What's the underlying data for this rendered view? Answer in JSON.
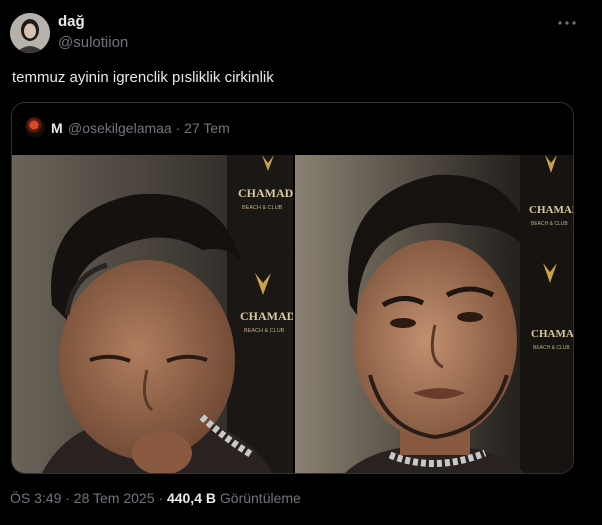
{
  "author": {
    "name": "dağ",
    "handle": "@sulotiion"
  },
  "menu_icon": "more-horizontal-icon",
  "tweet_text": "temmuz ayinin igrenclik pısliklik cirkinlik",
  "quoted": {
    "name": "M",
    "handle": "@osekilgelamaa",
    "separator": "·",
    "date": "27 Tem",
    "images": [
      {
        "brand_text": "CHAMADA",
        "sub_text": "BEACH & CLUB"
      },
      {
        "brand_text": "CHAMADA",
        "sub_text": "BEACH & CLUB"
      }
    ]
  },
  "footer": {
    "timestamp": "ÖS 3:49 · 28 Tem 2025 ·",
    "views_count": "440,4 B",
    "views_label": "Görüntüleme"
  },
  "colors": {
    "background": "#000000",
    "text": "#e7e9ea",
    "muted": "#71767b",
    "border": "#2f3336",
    "gold": "#c8a24a"
  }
}
